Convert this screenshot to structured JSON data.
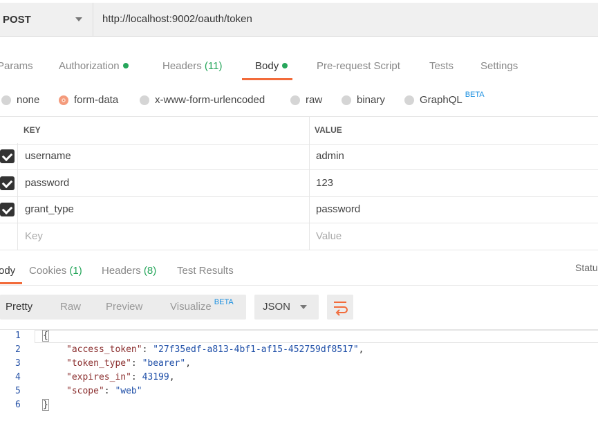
{
  "request": {
    "method": "POST",
    "url": "http://localhost:9002/oauth/token"
  },
  "request_tabs": [
    {
      "label": "Params"
    },
    {
      "label": "Authorization"
    },
    {
      "label": "Headers",
      "count": "(11)"
    },
    {
      "label": "Body"
    },
    {
      "label": "Pre-request Script"
    },
    {
      "label": "Tests"
    },
    {
      "label": "Settings"
    }
  ],
  "body_types": [
    {
      "label": "none"
    },
    {
      "label": "form-data"
    },
    {
      "label": "x-www-form-urlencoded"
    },
    {
      "label": "raw"
    },
    {
      "label": "binary"
    },
    {
      "label": "GraphQL",
      "badge": "BETA"
    }
  ],
  "form_table": {
    "columns": [
      "KEY",
      "VALUE"
    ],
    "rows": [
      {
        "key": "username",
        "value": "admin"
      },
      {
        "key": "password",
        "value": "123"
      },
      {
        "key": "grant_type",
        "value": "password"
      }
    ],
    "placeholder": {
      "key": "Key",
      "value": "Value"
    }
  },
  "response_tabs": [
    {
      "label": "ody"
    },
    {
      "label": "Cookies",
      "count": "(1)"
    },
    {
      "label": "Headers",
      "count": "(8)"
    },
    {
      "label": "Test Results"
    }
  ],
  "status_label": "Statu",
  "view_modes": [
    {
      "label": "Pretty"
    },
    {
      "label": "Raw"
    },
    {
      "label": "Preview"
    },
    {
      "label": "Visualize",
      "badge": "BETA"
    }
  ],
  "format": "JSON",
  "line_numbers": [
    "1",
    "2",
    "3",
    "4",
    "5",
    "6"
  ],
  "response_json": {
    "open": "{",
    "close": "}",
    "lines": [
      {
        "key": "\"access_token\"",
        "value": "\"27f35edf-a813-4bf1-af15-452759df8517\"",
        "suffix": ","
      },
      {
        "key": "\"token_type\"",
        "value": "\"bearer\"",
        "suffix": ","
      },
      {
        "key": "\"expires_in\"",
        "value": "43199",
        "suffix": ","
      },
      {
        "key": "\"scope\"",
        "value": "\"web\"",
        "suffix": ""
      }
    ]
  },
  "colors": {
    "accent": "#f26b3a",
    "success": "#26a65b",
    "beta": "#1a8fe0"
  }
}
